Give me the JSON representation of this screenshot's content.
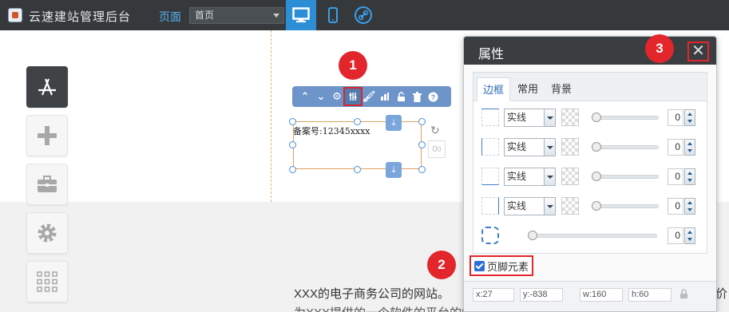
{
  "topbar": {
    "app_title": "云速建站管理后台",
    "page_label": "页面",
    "page_select_value": "首页",
    "devices": [
      "desktop-icon",
      "mobile-icon",
      "link-icon"
    ]
  },
  "left_tools": [
    "app-store-icon",
    "plus-icon",
    "toolbox-icon",
    "gear-icon",
    "grid-icon"
  ],
  "element": {
    "text": "备案号:12345xxxx",
    "degree": "0",
    "degree_sup": "0",
    "toolbar_icons": [
      "chevron-up-icon",
      "chevron-down-icon",
      "gear-icon",
      "properties-icon",
      "brush-icon",
      "chart-icon",
      "unlock-icon",
      "trash-icon",
      "help-icon"
    ]
  },
  "badges": {
    "b1": "1",
    "b2": "2",
    "b3": "3"
  },
  "panel": {
    "title": "属性",
    "close": "✕",
    "tabs": [
      "边框",
      "常用",
      "背景"
    ],
    "border_rows": [
      {
        "side": "top",
        "style": "实线",
        "value": "0"
      },
      {
        "side": "left",
        "style": "实线",
        "value": "0"
      },
      {
        "side": "bottom",
        "style": "实线",
        "value": "0"
      },
      {
        "side": "right",
        "style": "实线",
        "value": "0"
      }
    ],
    "radius_value": "0",
    "footer_element_label": "页脚元素",
    "coords": {
      "x": "x:27",
      "y": "y:-838",
      "w": "w:160",
      "h": "h:60"
    }
  },
  "footer": {
    "line1": "XXX的电子商务公司的网站。",
    "line2": "为XXX提供的一个软件的平台的解决方案",
    "right_char": "价"
  },
  "colors": {
    "accent": "#2d8ed6",
    "highlight": "#e2262c",
    "topbar": "#35393c"
  }
}
